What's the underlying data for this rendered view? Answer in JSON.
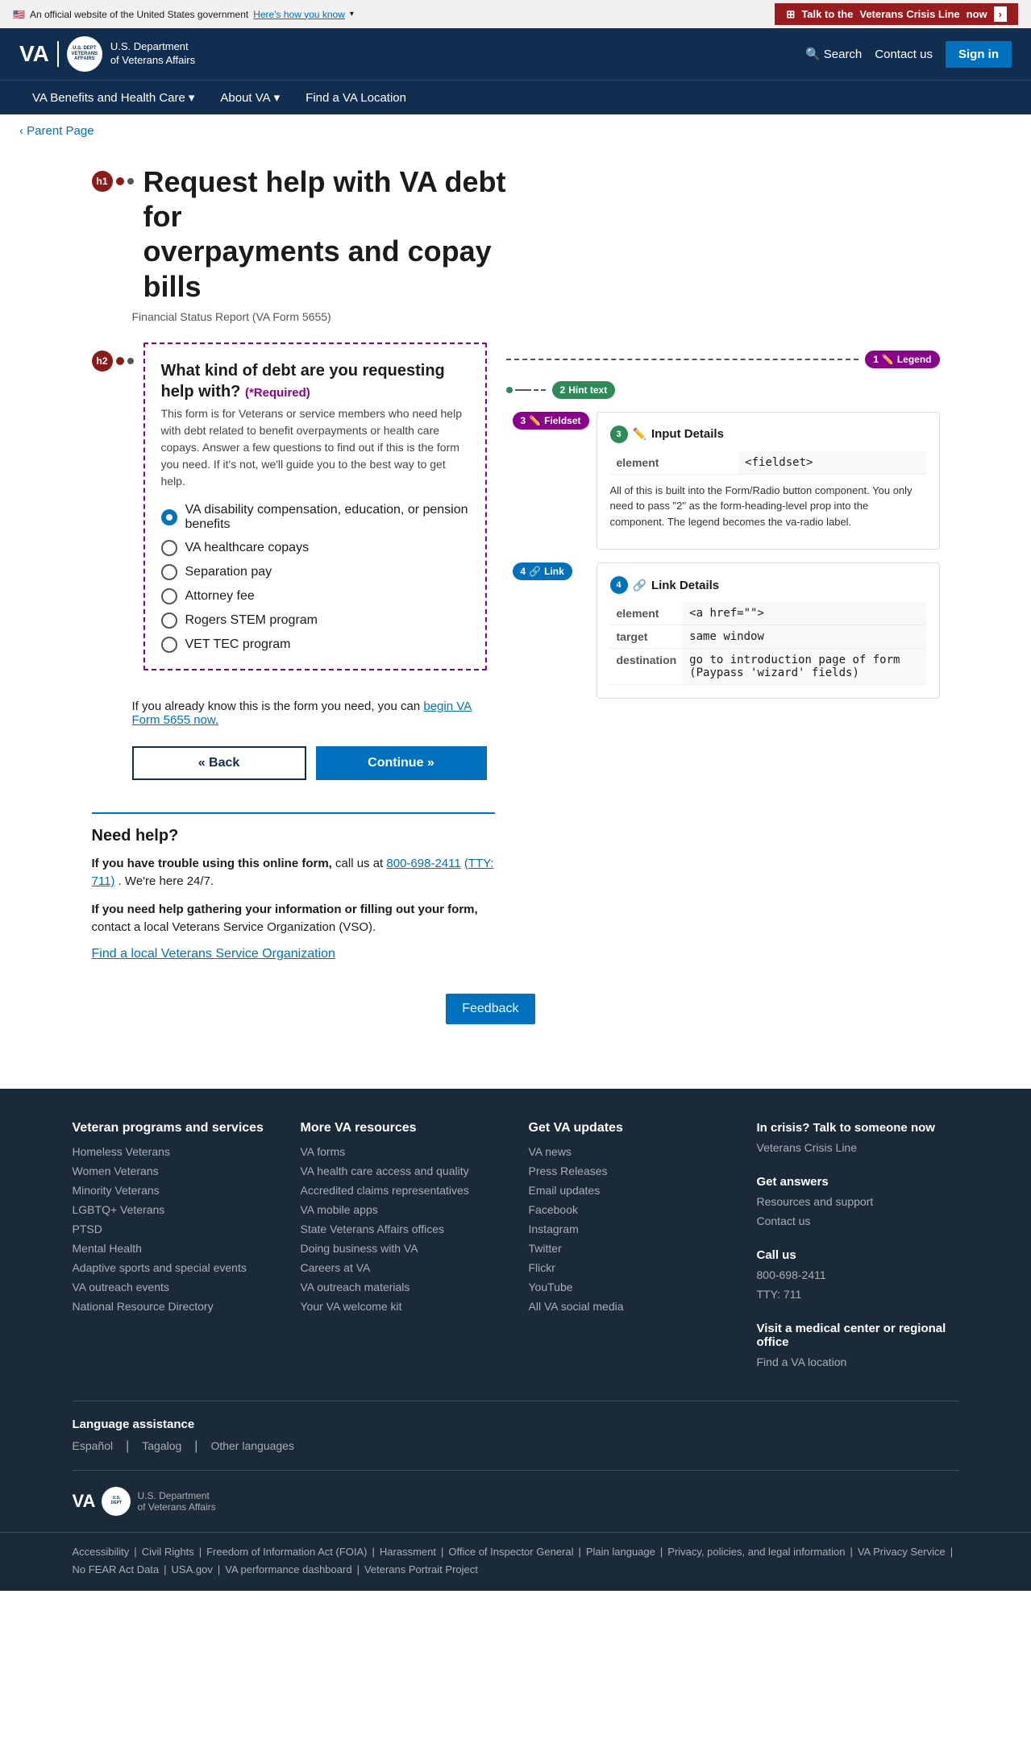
{
  "topBanner": {
    "officialText": "An official website of the United States government",
    "howYouKnowText": "Here's how you know",
    "crisisText": "Talk to the",
    "crisisHighlight": "Veterans Crisis Line",
    "crisisNow": "now"
  },
  "header": {
    "logoText": "VA",
    "deptLine1": "U.S. Department",
    "deptLine2": "of Veterans Affairs",
    "searchLabel": "Search",
    "contactLabel": "Contact us",
    "signinLabel": "Sign in"
  },
  "nav": {
    "items": [
      {
        "label": "VA Benefits and Health Care",
        "hasDropdown": true
      },
      {
        "label": "About VA",
        "hasDropdown": true
      },
      {
        "label": "Find a VA Location",
        "hasDropdown": false
      }
    ]
  },
  "breadcrumb": {
    "label": "Parent Page"
  },
  "annotations": {
    "h1Badge": "h1",
    "h2Badge": "h2",
    "badge1": "1",
    "badge1Label": "Legend",
    "badge2": "2",
    "badge2Label": "Hint text",
    "badge3a": "3",
    "badge3aLabel": "Fieldset",
    "badge3b": "3",
    "badge3bLabel": "Input Details",
    "badge4a": "4",
    "badge4aLabel": "Link",
    "badge4b": "4",
    "badge4bLabel": "Link Details",
    "inputDetailsElement": "<fieldset>",
    "inputDetailsBody": "All of this is built into the Form/Radio button component. You only need to pass \"2\" as the form-heading-level prop into the component. The legend becomes the va-radio label.",
    "linkDetailsElement": "<a href=\"\">",
    "linkDetailsTarget": "same window",
    "linkDetailsDestination": "go to introduction page of form (Paypass 'wizard' fields)"
  },
  "pageTitle": {
    "line1": "Request help with VA debt for",
    "line2": "overpayments and copay bills",
    "subtitle": "Financial Status Report (VA Form 5655)"
  },
  "formSection": {
    "question": "What kind of debt are you requesting help with?",
    "required": "(*Required)",
    "hint": "This form is for Veterans or service members who need help with debt related to benefit overpayments or health care copays. Answer a few questions to find out if this is the form you need. If it's not, we'll guide you to the best way to get help.",
    "options": [
      {
        "label": "VA disability compensation, education, or pension benefits",
        "selected": true
      },
      {
        "label": "VA healthcare copays",
        "selected": false
      },
      {
        "label": "Separation pay",
        "selected": false
      },
      {
        "label": "Attorney fee",
        "selected": false
      },
      {
        "label": "Rogers STEM program",
        "selected": false
      },
      {
        "label": "VET TEC program",
        "selected": false
      }
    ]
  },
  "inlineLink": {
    "prefix": "If you already know this is the form you need, you can ",
    "linkText": "begin VA Form 5655 now.",
    "suffix": ""
  },
  "buttons": {
    "back": "« Back",
    "continue": "Continue »"
  },
  "needHelp": {
    "heading": "Need help?",
    "onlineFormLabel": "If you have trouble using this online form,",
    "onlineFormText": " call us at ",
    "phone": "800-698-2411",
    "tty": "(TTY: 711)",
    "hoursText": ". We're here 24/7.",
    "gatheringLabel": "If you need help gathering your information or filling out your form,",
    "gatheringText": " contact a local Veterans Service Organization (VSO).",
    "findVsoText": "Find a local Veterans Service Organization"
  },
  "feedback": {
    "label": "Feedback"
  },
  "footer": {
    "col1": {
      "heading": "Veteran programs and services",
      "links": [
        "Homeless Veterans",
        "Women Veterans",
        "Minority Veterans",
        "LGBTQ+ Veterans",
        "PTSD",
        "Mental Health",
        "Adaptive sports and special events",
        "VA outreach events",
        "National Resource Directory"
      ]
    },
    "col2": {
      "heading": "More VA resources",
      "links": [
        "VA forms",
        "VA health care access and quality",
        "Accredited claims representatives",
        "VA mobile apps",
        "State Veterans Affairs offices",
        "Doing business with VA",
        "Careers at VA",
        "VA outreach materials",
        "Your VA welcome kit"
      ]
    },
    "col3": {
      "heading": "Get VA updates",
      "links": [
        "VA news",
        "Press Releases",
        "Email updates",
        "Facebook",
        "Instagram",
        "Twitter",
        "Flickr",
        "YouTube",
        "All VA social media"
      ]
    },
    "col4": {
      "crisisHeading": "In crisis? Talk to someone now",
      "crisisLink": "Veterans Crisis Line",
      "answersHeading": "Get answers",
      "answersLinks": [
        "Resources and support",
        "Contact us"
      ],
      "callHeading": "Call us",
      "phone": "800-698-2411",
      "tty": "TTY: 711",
      "visitHeading": "Visit a medical center or regional office",
      "visitLink": "Find a VA location"
    },
    "language": {
      "heading": "Language assistance",
      "links": [
        "Español",
        "Tagalog",
        "Other languages"
      ]
    },
    "legal": {
      "links": [
        "Accessibility",
        "Civil Rights",
        "Freedom of Information Act (FOIA)",
        "Harassment",
        "Office of Inspector General",
        "Plain language",
        "Privacy, policies, and legal information",
        "VA Privacy Service",
        "No FEAR Act Data",
        "USA.gov",
        "VA performance dashboard",
        "Veterans Portrait Project"
      ]
    }
  }
}
